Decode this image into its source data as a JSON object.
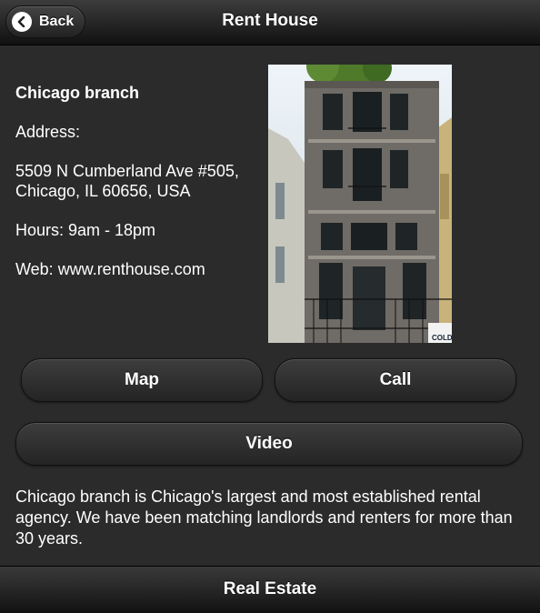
{
  "header": {
    "back_label": "Back",
    "title": "Rent House"
  },
  "info": {
    "branch_name": "Chicago branch",
    "address_label": "Address:",
    "address_line1": "5509 N Cumberland Ave #505,",
    "address_line2": "Chicago, IL 60656, USA",
    "hours": "Hours: 9am - 18pm",
    "web": "Web: www.renthouse.com"
  },
  "photo": {
    "sign_text": "COLD"
  },
  "buttons": {
    "map_label": "Map",
    "call_label": "Call",
    "video_label": "Video"
  },
  "description": "Chicago branch is Chicago's largest and most established rental agency. We have been matching landlords and renters for more than 30 years.",
  "footer": {
    "title": "Real Estate"
  },
  "colors": {
    "background": "#2b2b2b",
    "bar": "#1c1c1c",
    "text": "#ffffff"
  }
}
